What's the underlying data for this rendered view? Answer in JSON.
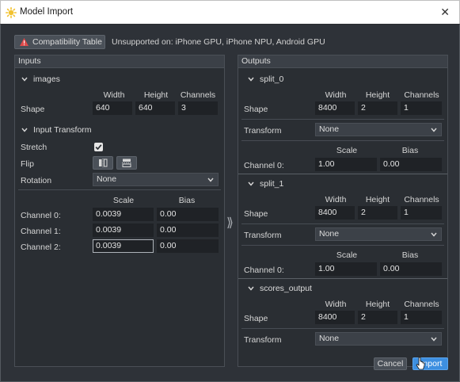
{
  "window": {
    "title": "Model Import",
    "close_glyph": "✕",
    "app_icon": "sun-icon"
  },
  "toolbar": {
    "compat_button": "Compatibility Table",
    "compat_icon": "warning-icon",
    "unsupported": "Unsupported on: iPhone GPU, iPhone NPU, Android GPU"
  },
  "inputs": {
    "header": "Inputs",
    "images": {
      "title": "images",
      "cols": [
        "Width",
        "Height",
        "Channels"
      ],
      "shape_label": "Shape",
      "shape": [
        "640",
        "640",
        "3"
      ]
    },
    "transform": {
      "title": "Input Transform",
      "stretch_label": "Stretch",
      "stretch_checked": true,
      "flip_label": "Flip",
      "rotation_label": "Rotation",
      "rotation_value": "None",
      "scale_label": "Scale",
      "bias_label": "Bias",
      "channels": [
        {
          "label": "Channel 0:",
          "scale": "0.0039",
          "bias": "0.00"
        },
        {
          "label": "Channel 1:",
          "scale": "0.0039",
          "bias": "0.00"
        },
        {
          "label": "Channel 2:",
          "scale": "0.0039",
          "bias": "0.00"
        }
      ]
    }
  },
  "arrow_glyph": "⟫",
  "outputs": {
    "header": "Outputs",
    "sections": [
      {
        "title": "split_0",
        "cols": [
          "Width",
          "Height",
          "Channels"
        ],
        "shape_label": "Shape",
        "shape": [
          "8400",
          "2",
          "1"
        ],
        "transform_label": "Transform",
        "transform_value": "None",
        "scale_label": "Scale",
        "bias_label": "Bias",
        "channel_label": "Channel 0:",
        "scale": "1.00",
        "bias": "0.00"
      },
      {
        "title": "split_1",
        "cols": [
          "Width",
          "Height",
          "Channels"
        ],
        "shape_label": "Shape",
        "shape": [
          "8400",
          "2",
          "1"
        ],
        "transform_label": "Transform",
        "transform_value": "None",
        "scale_label": "Scale",
        "bias_label": "Bias",
        "channel_label": "Channel 0:",
        "scale": "1.00",
        "bias": "0.00"
      },
      {
        "title": "scores_output",
        "cols": [
          "Width",
          "Height",
          "Channels"
        ],
        "shape_label": "Shape",
        "shape": [
          "8400",
          "2",
          "1"
        ],
        "transform_label": "Transform",
        "transform_value": "None"
      }
    ]
  },
  "footer": {
    "cancel": "Cancel",
    "import": "Import"
  },
  "colors": {
    "accent": "#3d8fe0",
    "panel": "#2a2e33",
    "warning": "#e04b4b"
  }
}
